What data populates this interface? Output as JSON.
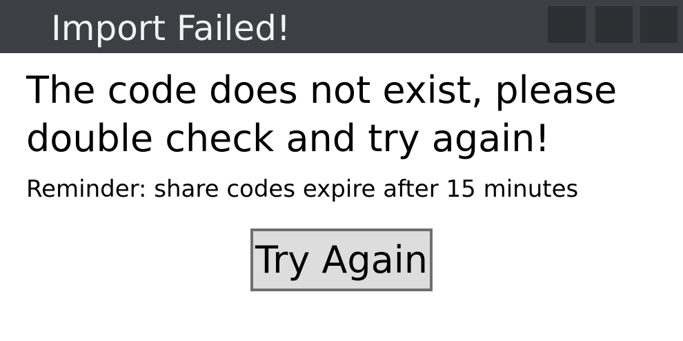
{
  "window": {
    "title": "Import Failed!"
  },
  "dialog": {
    "message": "The code does not exist, please double check and try again!",
    "reminder": "Reminder: share codes expire after 15 minutes",
    "try_again_label": "Try Again"
  },
  "colors": {
    "titlebar_bg": "#3e3f45",
    "title_text": "#f2f2f2",
    "window_button_bg": "#2e2f33",
    "button_bg": "#dddddd",
    "button_border": "#6f6f6f"
  }
}
